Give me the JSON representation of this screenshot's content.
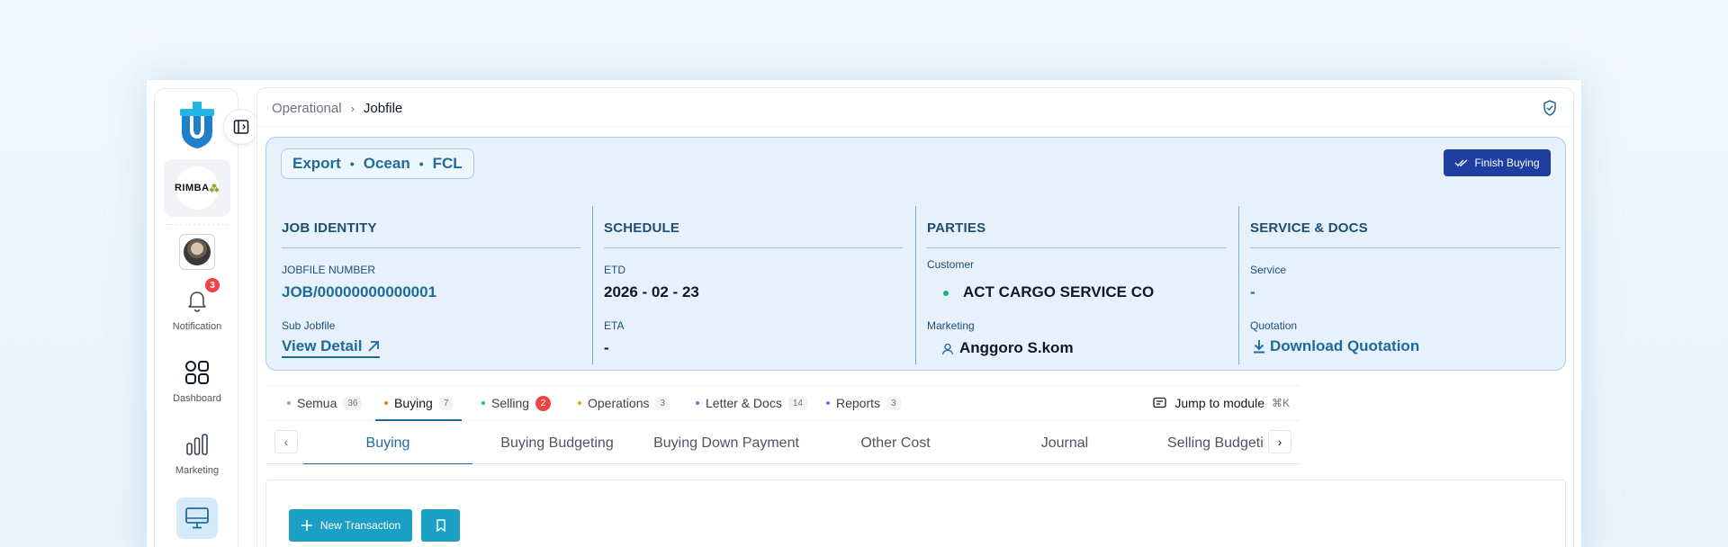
{
  "sidebar": {
    "company_logo_text": "RIMBA",
    "notification_count": "3",
    "items": [
      {
        "label": "Notification",
        "icon": "bell-icon"
      },
      {
        "label": "Dashboard",
        "icon": "grid-icon"
      },
      {
        "label": "Marketing",
        "icon": "bar-chart-icon"
      },
      {
        "label": "",
        "icon": "monitor-icon"
      }
    ]
  },
  "breadcrumb": {
    "parent": "Operational",
    "separator": "›",
    "current": "Jobfile"
  },
  "job": {
    "mode": [
      "Export",
      "Ocean",
      "FCL"
    ],
    "finish_button": "Finish Buying",
    "identity": {
      "heading": "JOB IDENTITY",
      "number_label": "JOBFILE NUMBER",
      "number_value": "JOB/00000000000001",
      "sub_label": "Sub Jobfile",
      "sub_link": "View Detail"
    },
    "schedule": {
      "heading": "SCHEDULE",
      "etd_label": "ETD",
      "etd_value": "2026 - 02 - 23",
      "eta_label": "ETA",
      "eta_value": "-"
    },
    "parties": {
      "heading": "PARTIES",
      "customer_label": "Customer",
      "customer_value": "ACT CARGO SERVICE CO",
      "marketing_label": "Marketing",
      "marketing_value": "Anggoro S.kom"
    },
    "service": {
      "heading": "SERVICE & DOCS",
      "service_label": "Service",
      "service_value": "-",
      "quotation_label": "Quotation",
      "quotation_link": "Download Quotation"
    }
  },
  "module_tabs": [
    {
      "label": "Semua",
      "count": "36",
      "color": "#9ca3af"
    },
    {
      "label": "Buying",
      "count": "7",
      "color": "#f97316"
    },
    {
      "label": "Selling",
      "count": "2",
      "color": "#14b8a6"
    },
    {
      "label": "Operations",
      "count": "3",
      "color": "#f59e0b"
    },
    {
      "label": "Letter & Docs",
      "count": "14",
      "color": "#8b5cf6"
    },
    {
      "label": "Reports",
      "count": "3",
      "color": "#3b82f6"
    }
  ],
  "jump": {
    "label": "Jump to module",
    "shortcut": "⌘K"
  },
  "sub_tabs": [
    "Buying",
    "Buying Budgeting",
    "Buying Down Payment",
    "Other Cost",
    "Journal",
    "Selling Budgeting"
  ],
  "actions": {
    "new_transaction": "New Transaction"
  },
  "colors": {
    "accent": "#1f6a9c",
    "primary_button": "#1e3fa0",
    "action_button": "#1b9fc4",
    "card_bg": "#e6f1fb"
  }
}
